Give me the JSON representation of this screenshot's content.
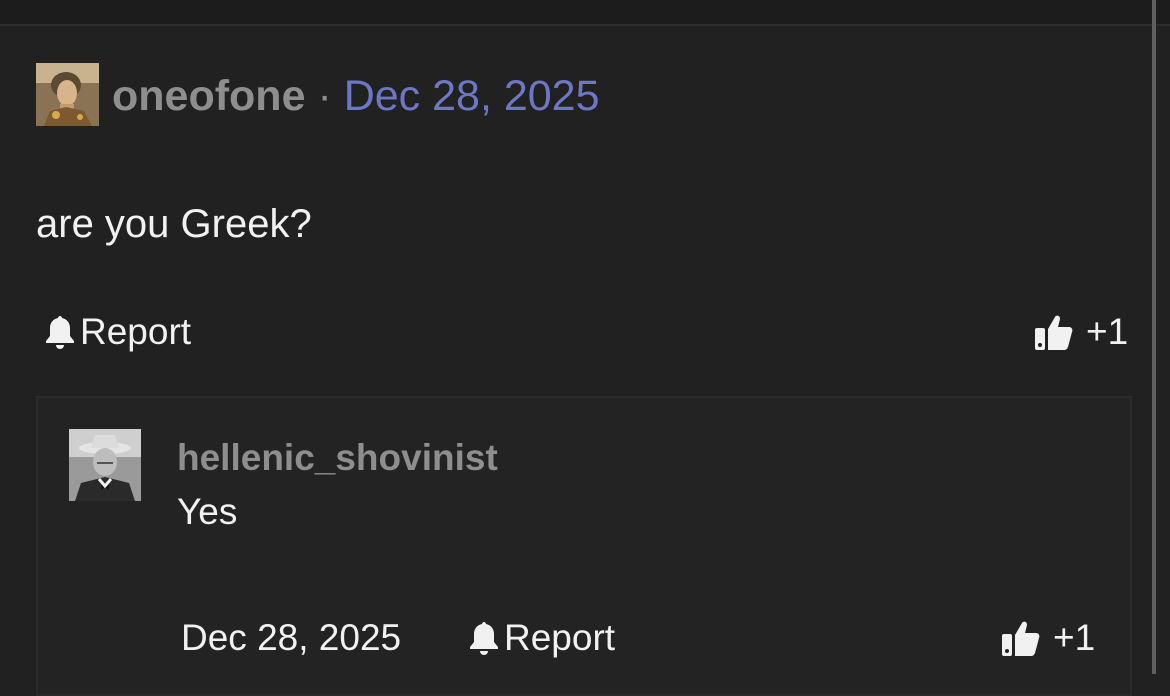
{
  "post": {
    "author": "oneofone",
    "separator": "·",
    "date": "Dec 28, 2025",
    "body": "are you Greek?",
    "report_label": "Report",
    "vote_label": "+1",
    "avatar_icon": "portrait-avatar",
    "report_icon": "bell-icon",
    "vote_icon": "thumbs-up-icon"
  },
  "reply": {
    "author": "hellenic_shovinist",
    "body": "Yes",
    "date": "Dec 28, 2025",
    "report_label": "Report",
    "vote_label": "+1",
    "avatar_icon": "bw-portrait-avatar"
  },
  "colors": {
    "background": "#212121",
    "username": "#8e8e8e",
    "date_link": "#6e77c6",
    "text": "#f1f1f1"
  }
}
